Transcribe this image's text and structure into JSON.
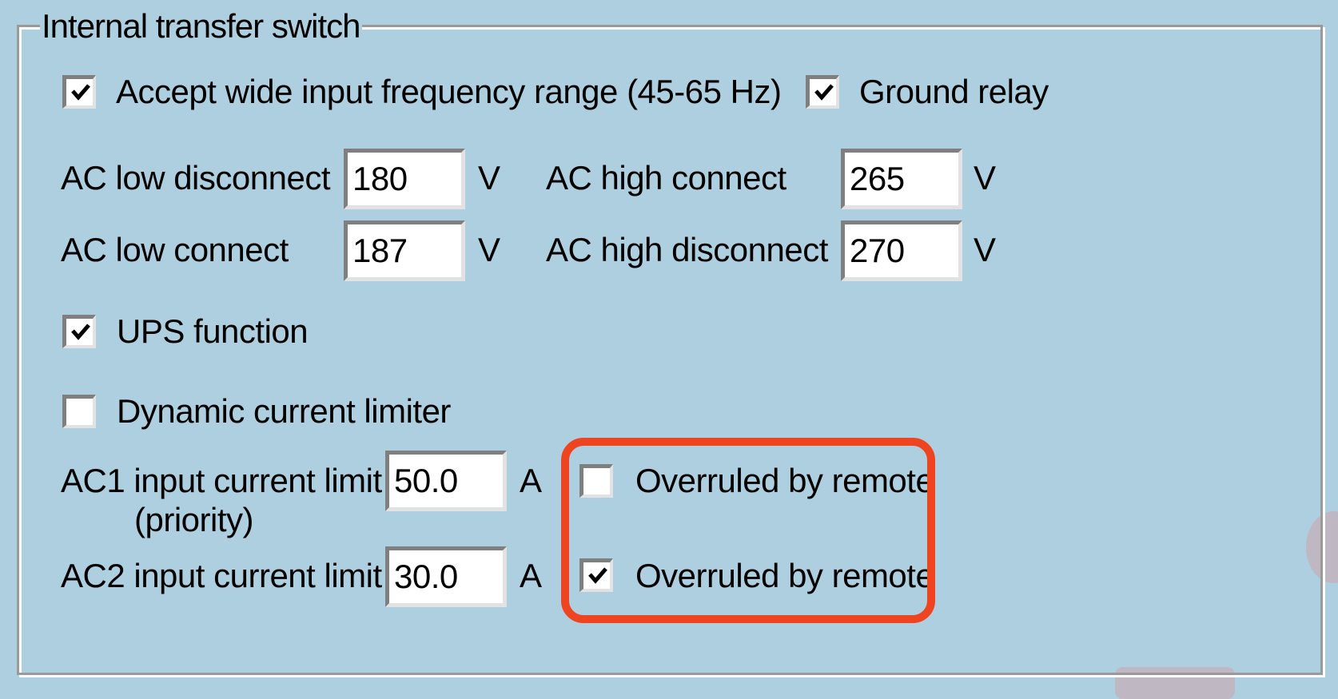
{
  "group": {
    "title": "Internal transfer switch"
  },
  "checkboxes": {
    "wide_frequency": {
      "label": "Accept wide input frequency range (45-65 Hz)",
      "checked": true
    },
    "ground_relay": {
      "label": "Ground relay",
      "checked": true
    },
    "ups_function": {
      "label": "UPS function",
      "checked": true
    },
    "dynamic_current_limiter": {
      "label": "Dynamic current limiter",
      "checked": false
    },
    "ac1_overruled": {
      "label": "Overruled by remote",
      "checked": false
    },
    "ac2_overruled": {
      "label": "Overruled by remote",
      "checked": true
    }
  },
  "fields": {
    "ac_low_disconnect": {
      "label": "AC low disconnect",
      "value": "180",
      "unit": "V"
    },
    "ac_low_connect": {
      "label": "AC low connect",
      "value": "187",
      "unit": "V"
    },
    "ac_high_connect": {
      "label": "AC high connect",
      "value": "265",
      "unit": "V"
    },
    "ac_high_disconnect": {
      "label": "AC high disconnect",
      "value": "270",
      "unit": "V"
    },
    "ac1_input_current_limit": {
      "label": "AC1 input current limit",
      "sublabel": "(priority)",
      "value": "50.0",
      "unit": "A"
    },
    "ac2_input_current_limit": {
      "label": "AC2 input current limit",
      "value": "30.0",
      "unit": "A"
    }
  },
  "colors": {
    "background": "#aecfdf",
    "highlight": "#ee4420"
  }
}
